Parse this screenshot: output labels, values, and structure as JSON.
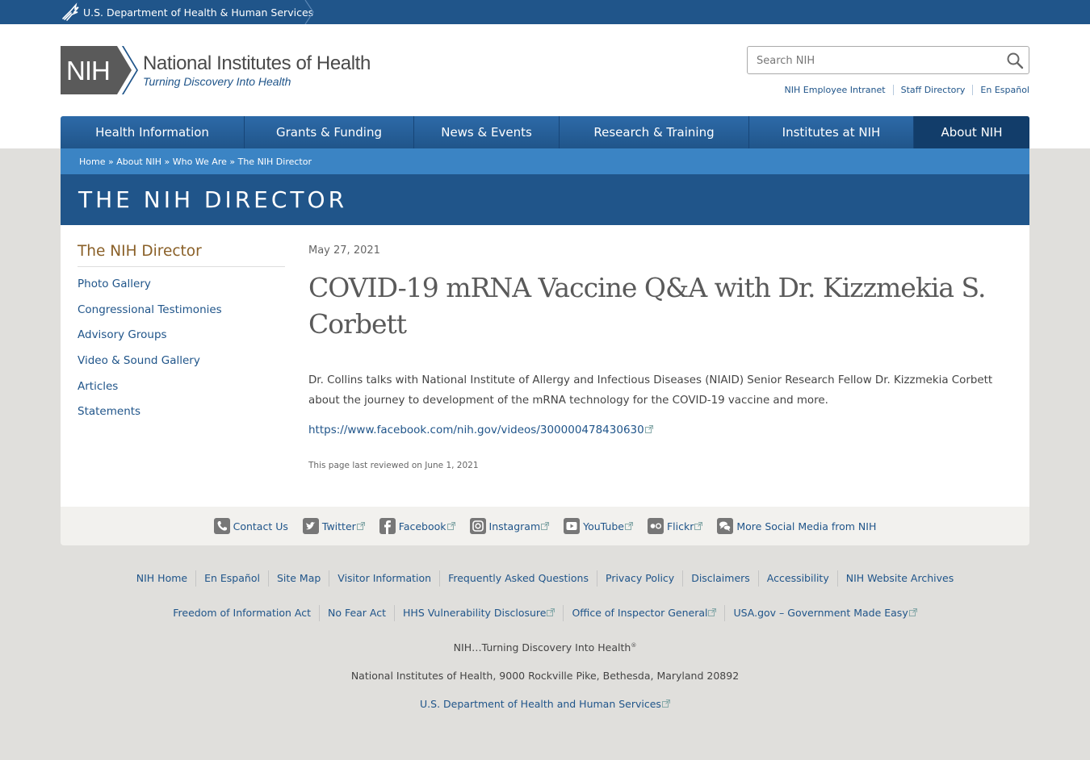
{
  "hhs_bar": {
    "label": "U.S. Department of Health & Human Services"
  },
  "logo": {
    "mark_text": "NIH",
    "name": "National Institutes of Health",
    "tagline": "Turning Discovery Into Health"
  },
  "search": {
    "placeholder": "Search NIH"
  },
  "util_links": [
    "NIH Employee Intranet",
    "Staff Directory",
    "En Español"
  ],
  "nav": {
    "items": [
      {
        "label": "Health Information",
        "active": false
      },
      {
        "label": "Grants & Funding",
        "active": false
      },
      {
        "label": "News & Events",
        "active": false
      },
      {
        "label": "Research & Training",
        "active": false
      },
      {
        "label": "Institutes at NIH",
        "active": false
      },
      {
        "label": "About NIH",
        "active": true
      }
    ]
  },
  "breadcrumb": [
    "Home",
    "About NIH",
    "Who We Are",
    "The NIH Director"
  ],
  "breadcrumb_separator": " » ",
  "banner": {
    "title": "THE NIH DIRECTOR"
  },
  "sidebar": {
    "title": "The NIH Director",
    "items": [
      "Photo Gallery",
      "Congressional Testimonies",
      "Advisory Groups",
      "Video & Sound Gallery",
      "Articles",
      "Statements"
    ]
  },
  "article": {
    "date": "May 27, 2021",
    "title": "COVID-19 mRNA Vaccine Q&A with Dr. Kizzmekia S. Corbett",
    "body": "Dr. Collins talks with National Institute of Allergy and Infectious Diseases (NIAID) Senior Research Fellow Dr. Kizzmekia Corbett about the journey to development of the mRNA technology for the COVID-19 vaccine and more.",
    "link": "https://www.facebook.com/nih.gov/videos/300000478430630",
    "reviewed": "This page last reviewed on June 1, 2021"
  },
  "social": [
    {
      "label": "Contact Us",
      "icon": "phone-icon",
      "external": false
    },
    {
      "label": "Twitter",
      "icon": "twitter-icon",
      "external": true
    },
    {
      "label": "Facebook",
      "icon": "facebook-icon",
      "external": true
    },
    {
      "label": "Instagram",
      "icon": "instagram-icon",
      "external": true
    },
    {
      "label": "YouTube",
      "icon": "youtube-icon",
      "external": true
    },
    {
      "label": "Flickr",
      "icon": "flickr-icon",
      "external": true
    },
    {
      "label": "More Social Media from NIH",
      "icon": "chat-bubbles-icon",
      "external": false
    }
  ],
  "footer": {
    "row1": [
      "NIH Home",
      "En Español",
      "Site Map",
      "Visitor Information",
      "Frequently Asked Questions",
      "Privacy Policy",
      "Disclaimers",
      "Accessibility",
      "NIH Website Archives"
    ],
    "row2": [
      {
        "label": "Freedom of Information Act",
        "external": false
      },
      {
        "label": "No Fear Act",
        "external": false
      },
      {
        "label": "HHS Vulnerability Disclosure",
        "external": true
      },
      {
        "label": "Office of Inspector General",
        "external": true
      },
      {
        "label": "USA.gov – Government Made Easy",
        "external": true
      }
    ],
    "tagline": "NIH…Turning Discovery Into Health",
    "tagline_mark": "®",
    "address": "National Institutes of Health, 9000 Rockville Pike, Bethesda, Maryland 20892",
    "hhs_link": "U.S. Department of Health and Human Services"
  },
  "colors": {
    "primary": "#20558a",
    "breadcrumb": "#3b84c4",
    "accent_title": "#8a6028",
    "page_bg": "#e0dfdc"
  }
}
